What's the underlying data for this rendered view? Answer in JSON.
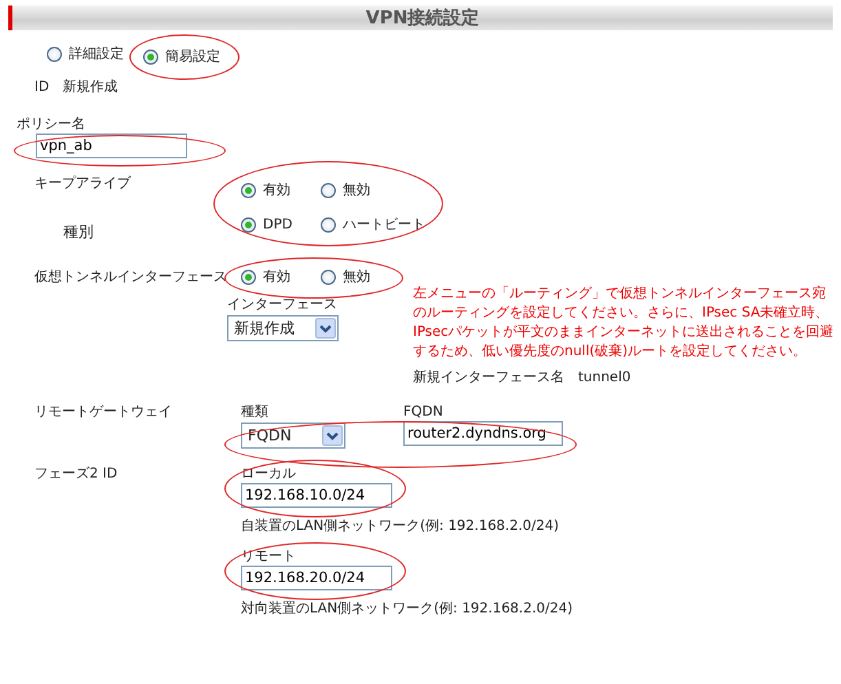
{
  "header": {
    "title": "VPN接続設定"
  },
  "mode_options": [
    {
      "label": "詳細設定",
      "selected": false
    },
    {
      "label": "簡易設定",
      "selected": true
    }
  ],
  "id": {
    "label": "ID",
    "value": "新規作成"
  },
  "policy_name": {
    "label": "ポリシー名",
    "value": "vpn_ab"
  },
  "keepalive": {
    "label": "キープアライブ",
    "options": [
      {
        "label": "有効",
        "selected": true
      },
      {
        "label": "無効",
        "selected": false
      }
    ],
    "type_label": "種別",
    "type_options": [
      {
        "label": "DPD",
        "selected": true
      },
      {
        "label": "ハートビート",
        "selected": false
      }
    ]
  },
  "tunnel_interface": {
    "label": "仮想トンネルインターフェース",
    "options": [
      {
        "label": "有効",
        "selected": true
      },
      {
        "label": "無効",
        "selected": false
      }
    ],
    "interface_label": "インターフェース",
    "interface_value": "新規作成",
    "note": "左メニューの「ルーティング」で仮想トンネルインターフェース宛のルーティングを設定してください。さらに、IPsec SA未確立時、IPsecパケットが平文のままインターネットに送出されることを回避するため、低い優先度のnull(破棄)ルートを設定してください。",
    "new_name_label": "新規インターフェース名",
    "new_name_value": "tunnel0"
  },
  "remote_gateway": {
    "label": "リモートゲートウェイ",
    "kind_label": "種類",
    "kind_value": "FQDN",
    "fqdn_label": "FQDN",
    "fqdn_value": "router2.dyndns.org"
  },
  "phase2_id": {
    "label": "フェーズ2 ID",
    "local_label": "ローカル",
    "local_value": "192.168.10.0/24",
    "local_hint": "自装置のLAN側ネットワーク(例: 192.168.2.0/24)",
    "remote_label": "リモート",
    "remote_value": "192.168.20.0/24",
    "remote_hint": "対向装置のLAN側ネットワーク(例: 192.168.2.0/24)"
  }
}
